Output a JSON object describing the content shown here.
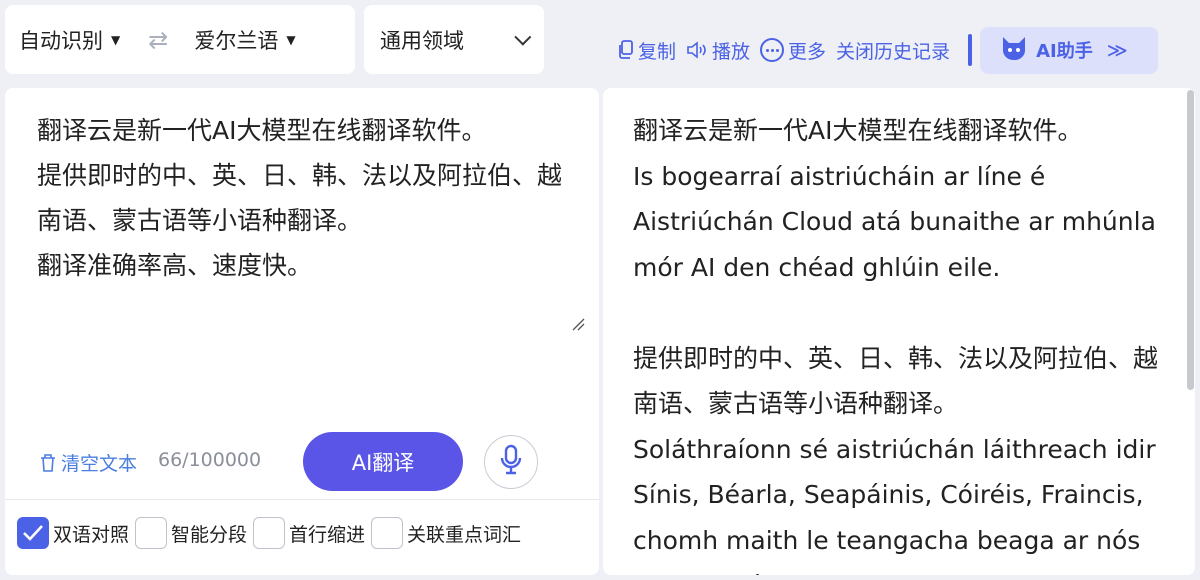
{
  "lang_bar": {
    "source_lang": "自动识别",
    "target_lang": "爱尔兰语",
    "swap_icon": "⇄"
  },
  "domain": {
    "label": "通用领域"
  },
  "toolbar": {
    "copy": "复制",
    "play": "播放",
    "more": "更多",
    "close_history": "关闭历史记录",
    "ai_assistant": "AI助手",
    "ai_assistant_arrows": "≫"
  },
  "source": {
    "text": "翻译云是新一代AI大模型在线翻译软件。\n提供即时的中、英、日、韩、法以及阿拉伯、越南语、蒙古语等小语种翻译。\n翻译准确率高、速度快。",
    "clear_label": "清空文本",
    "char_count": "66/100000",
    "translate_button": "AI翻译"
  },
  "options": [
    {
      "label": "双语对照",
      "checked": true
    },
    {
      "label": "智能分段",
      "checked": false
    },
    {
      "label": "首行缩进",
      "checked": false
    },
    {
      "label": "关联重点词汇",
      "checked": false
    }
  ],
  "output": {
    "para1_zh": "翻译云是新一代AI大模型在线翻译软件。",
    "para1_ga": "Is bogearraí aistriúcháin ar líne é Aistriúchán Cloud atá bunaithe ar mhúnla mór AI den chéad ghlúin eile.",
    "para2_zh": "提供即时的中、英、日、韩、法以及阿拉伯、越南语、蒙古语等小语种翻译。",
    "para2_ga": "Soláthraíonn sé aistriúchán láithreach idir Sínis, Béarla, Seapáinis, Cóiréis, Fraincis, chomh maith le teangacha beaga ar nós Araibis, Vítneaimis"
  },
  "colors": {
    "accent": "#4b62e6",
    "button": "#5a55e6",
    "background": "#eef0f5"
  }
}
